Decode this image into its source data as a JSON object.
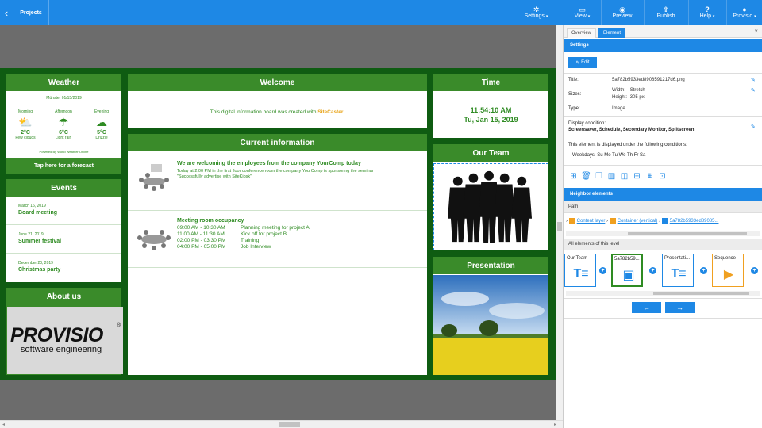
{
  "topbar": {
    "back_icon": "chevron-left",
    "projects_label": "Projects",
    "items": [
      {
        "icon": "gear-icon",
        "label": "Settings"
      },
      {
        "icon": "view-icon",
        "label": "View"
      },
      {
        "icon": "preview-icon",
        "label": "Preview"
      },
      {
        "icon": "upload-icon",
        "label": "Publish"
      },
      {
        "icon": "help-icon",
        "label": "Help"
      },
      {
        "icon": "user-icon",
        "label": "Provisio"
      }
    ]
  },
  "board": {
    "weather": {
      "title": "Weather",
      "date": "Münster 01/15/2019",
      "columns": [
        {
          "label": "Morning",
          "temp": "2°C",
          "desc": "Few clouds"
        },
        {
          "label": "Afternoon",
          "temp": "6°C",
          "desc": "Light rain"
        },
        {
          "label": "Evening",
          "temp": "5°C",
          "desc": "Drizzle"
        }
      ],
      "powered": "Powered By World Weather Online",
      "forecast_button": "Tap here for a forecast"
    },
    "events": {
      "title": "Events",
      "items": [
        {
          "date": "March 16, 2019",
          "title": "Board meeting"
        },
        {
          "date": "June 21, 2019",
          "title": "Summer festival"
        },
        {
          "date": "December 20, 2019",
          "title": "Christmas party"
        }
      ]
    },
    "about": {
      "title": "About us",
      "logo_main": "PROVISIO",
      "logo_sub": "software engineering",
      "logo_mark": "®"
    },
    "welcome": {
      "title": "Welcome",
      "text_pre": "This digital information board was created with ",
      "brand": "SiteCaster",
      "text_post": "."
    },
    "current": {
      "title": "Current information",
      "item1": {
        "title": "We are welcoming the employees from the company YourComp today",
        "line1": "Today at 2:00 PM in the first floor conference room the company YourComp is sponsoring the seminar",
        "line2": "\"Successfully advertise with SiteKiosk\""
      },
      "item2": {
        "title": "Meeting room occupancy",
        "rows": [
          {
            "time": "09:00 AM - 10:30 AM",
            "what": "Planning meeting for project A"
          },
          {
            "time": "11:00 AM - 11:30 AM",
            "what": "Kick off for project B"
          },
          {
            "time": "02:00 PM - 03:30 PM",
            "what": "Training"
          },
          {
            "time": "04:00 PM - 05:00 PM",
            "what": "Job Interview"
          }
        ]
      }
    },
    "time": {
      "title": "Time",
      "clock": "11:54:10 AM",
      "date": "Tu, Jan 15, 2019"
    },
    "team": {
      "title": "Our Team"
    },
    "presentation": {
      "title": "Presentation"
    }
  },
  "panel": {
    "tabs": [
      "Overview",
      "Element"
    ],
    "close": "×",
    "settings_header": "Settings",
    "edit_label": "Edit",
    "title_label": "Title:",
    "title_value": "5a782b5933ed8908591217d6.png",
    "sizes_label": "Sizes:",
    "width_label": "Width:",
    "width_value": "Stretch",
    "height_label": "Height:",
    "height_value": "305 px",
    "type_label": "Type:",
    "type_value": "Image",
    "display_label": "Display condition:",
    "display_value": "Screensaver, Schedule, Secondary Monitor, Splitscreen",
    "condition_text": "This element is displayed under the following conditions:",
    "weekdays": "Weekdays: Su Mo Tu We Th Fr Sa",
    "neighbor_header": "Neighbor elements",
    "path_label": "Path",
    "crumbs": [
      "Content layer",
      "Container (vertical)",
      "5a782b5933ed89085..."
    ],
    "all_label": "All elements of this level",
    "cards": [
      "Our Team",
      "5a782b59...",
      "Presentati...",
      "Sequence"
    ],
    "prev": "←",
    "next": "→"
  }
}
